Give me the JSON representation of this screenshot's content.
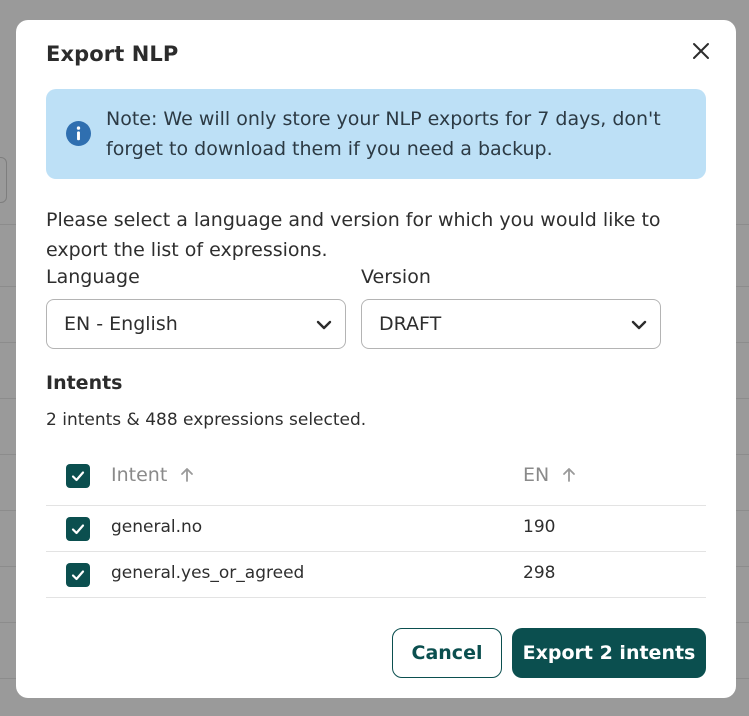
{
  "modal": {
    "title": "Export NLP",
    "info_note": "Note: We will only store your NLP exports for 7 days, don't forget to download them if you need a backup.",
    "description": "Please select a language and version for which you would like to export the list of expressions.",
    "language": {
      "label": "Language",
      "value": "EN - English"
    },
    "version": {
      "label": "Version",
      "value": "DRAFT"
    },
    "intents": {
      "title": "Intents",
      "summary": "2 intents & 488 expressions selected.",
      "columns": [
        "Intent",
        "EN"
      ],
      "rows": [
        {
          "intent": "general.no",
          "count": "190",
          "checked": true
        },
        {
          "intent": "general.yes_or_agreed",
          "count": "298",
          "checked": true
        }
      ]
    },
    "buttons": {
      "cancel": "Cancel",
      "export": "Export 2 intents"
    }
  },
  "colors": {
    "primary": "#0b4f4f",
    "info_bg": "#bde0f6",
    "info_icon": "#2f6fb0"
  },
  "icons": {
    "close": "close-icon",
    "info": "info-icon",
    "chevron": "chevron-down-icon",
    "sort": "arrow-up-icon",
    "check": "check-icon"
  }
}
